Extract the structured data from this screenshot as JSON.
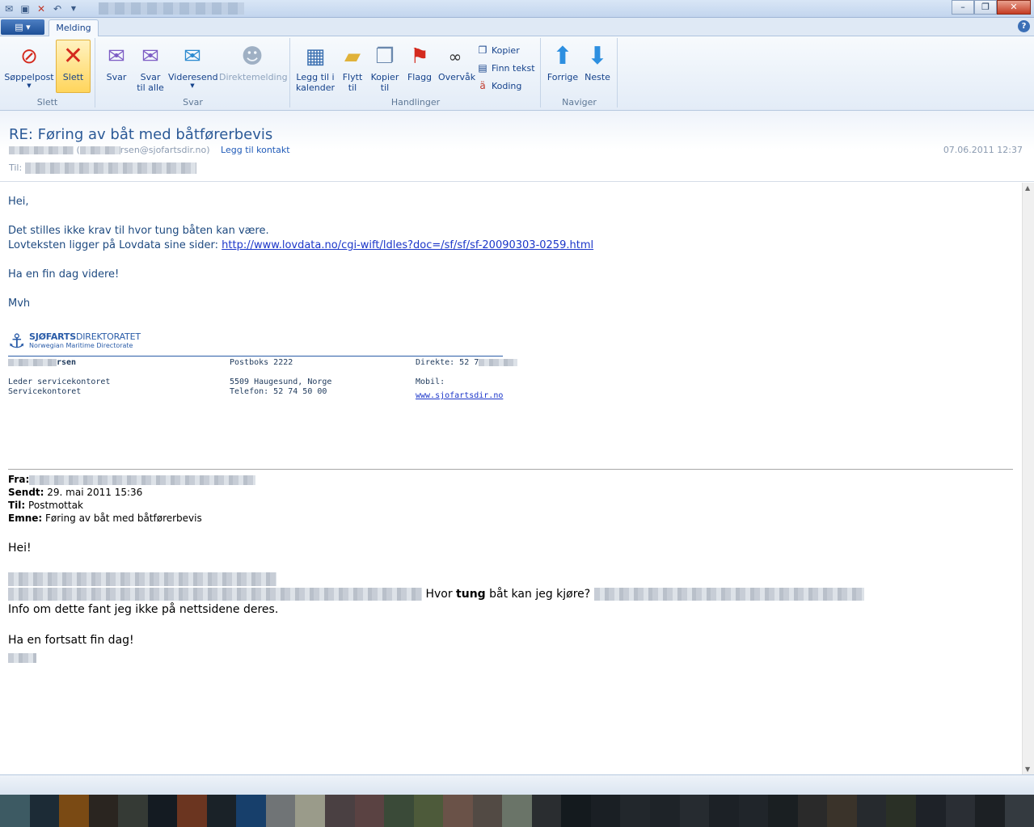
{
  "ribbon": {
    "tab": "Melding",
    "groups": {
      "slett": "Slett",
      "svar": "Svar",
      "handlinger": "Handlinger",
      "naviger": "Naviger"
    },
    "buttons": {
      "soppelpost": "Søppelpost",
      "slett": "Slett",
      "svar": "Svar",
      "svar_alle_1": "Svar",
      "svar_alle_2": "til alle",
      "videresend": "Videresend",
      "direktemelding": "Direktemelding",
      "kalender_1": "Legg til i",
      "kalender_2": "kalender",
      "flytt_1": "Flytt",
      "flytt_2": "til",
      "kopier_til_1": "Kopier",
      "kopier_til_2": "til",
      "flagg": "Flagg",
      "overvak": "Overvåk",
      "kopier": "Kopier",
      "finn_tekst": "Finn tekst",
      "koding": "Koding",
      "forrige": "Forrige",
      "neste": "Neste"
    }
  },
  "message": {
    "subject": "RE: Føring av båt med båtførerbevis",
    "sender_email_partial": "rsen@sjofartsdir.no)",
    "add_contact": "Legg til kontakt",
    "date": "07.06.2011 12:37",
    "to_label": "Til:",
    "body": {
      "greeting": "Hei,",
      "line1": "Det stilles ikke krav til hvor tung båten kan være.",
      "line2_prefix": "Lovteksten ligger på Lovdata sine sider: ",
      "link": "http://www.lovdata.no/cgi-wift/ldles?doc=/sf/sf/sf-20090303-0259.html",
      "closing": "Ha en fin dag videre!",
      "signoff": "Mvh"
    },
    "signature": {
      "logo_bold": "SJØFARTS",
      "logo_rest": "DIREKTORATET",
      "logo_sub": "Norwegian Maritime Directorate",
      "name_partial": "rsen",
      "postbox": "Postboks 2222",
      "direct": "Direkte: 52 7",
      "title1": "Leder servicekontoret",
      "title2": "Servicekontoret",
      "address": "5509 Haugesund, Norge",
      "phone": "Telefon: 52 74 50 00",
      "mobile": "Mobil:",
      "website": "www.sjofartsdir.no"
    },
    "quoted": {
      "fra_label": "Fra:",
      "sendt_label": "Sendt:",
      "sendt_value": "29. mai 2011 15:36",
      "til_label": "Til:",
      "til_value": "Postmottak",
      "emne_label": "Emne:",
      "emne_value": "Føring av båt med båtførerbevis",
      "greeting": "Hei!",
      "question_a": "Hvor ",
      "question_bold": "tung",
      "question_b": " båt kan jeg kjøre?",
      "info": "Info om dette fant jeg ikke på nettsidene deres.",
      "closing": "Ha en fortsatt fin dag!"
    }
  },
  "colors": {
    "accent": "#2c5a97",
    "link": "#1b36c9",
    "selected": "#ffd55c"
  },
  "icons": [
    "junk-icon",
    "delete-icon",
    "reply-icon",
    "reply-all-icon",
    "forward-icon",
    "instant-message-icon",
    "calendar-icon",
    "move-folder-icon",
    "copy-to-icon",
    "flag-icon",
    "watch-glasses-icon",
    "copy-icon",
    "find-text-icon",
    "encoding-icon",
    "previous-arrow-icon",
    "next-arrow-icon"
  ]
}
